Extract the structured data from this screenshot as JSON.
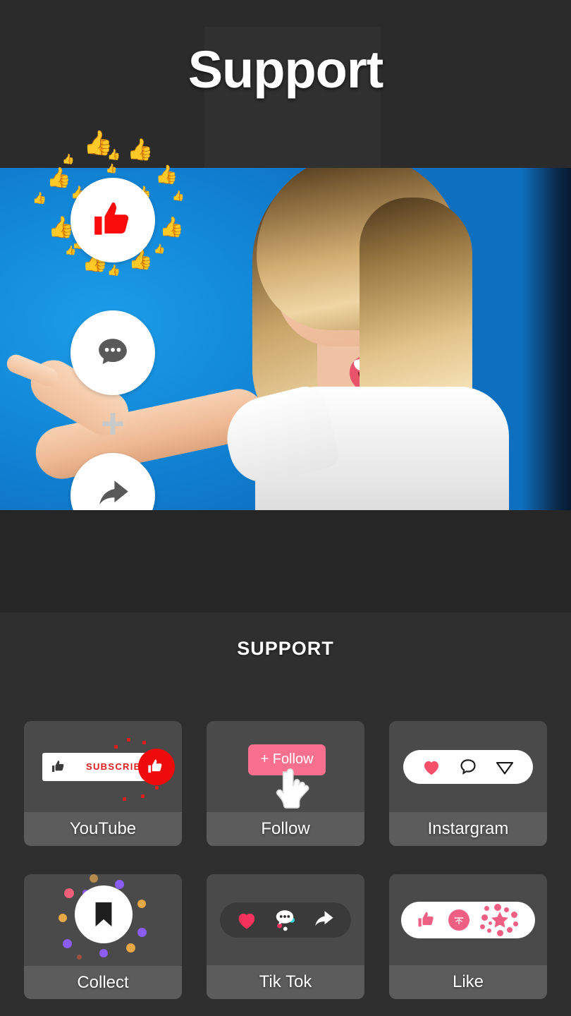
{
  "hero": {
    "title": "Support",
    "photo_alt": "woman pointing at social icons on blue background",
    "overlay_icons": [
      {
        "name": "like-thumbs-up",
        "color": "#f90b0b"
      },
      {
        "name": "comment-bubble",
        "color": "#595959"
      },
      {
        "name": "plus-sign",
        "label": "+",
        "color": "#c9c9c9"
      },
      {
        "name": "share-arrow",
        "color": "#595959"
      }
    ]
  },
  "panel": {
    "title": "SUPPORT",
    "cards": [
      {
        "id": "youtube",
        "label": "YouTube",
        "button_text": "SUBSCRIBE",
        "accent": "#ef0b0b",
        "art": "subscribe-bar"
      },
      {
        "id": "follow",
        "label": "Follow",
        "button_text": "+ Follow",
        "accent": "#f9708f",
        "art": "follow-button"
      },
      {
        "id": "instagram",
        "label": "Instargram",
        "accent": "#f4506a",
        "art": "instagram-pill"
      },
      {
        "id": "collect",
        "label": "Collect",
        "accent": "#ffffff",
        "art": "bookmark-burst"
      },
      {
        "id": "tiktok",
        "label": "Tik Tok",
        "accent": "#f4325c",
        "art": "tiktok-pill"
      },
      {
        "id": "like",
        "label": "Like",
        "accent": "#ef5f84",
        "art": "like-pill"
      }
    ]
  },
  "colors": {
    "page_bg": "#2a2a2a",
    "hero_bg": "#2b2b2b",
    "panel_bg": "#2f2f2f",
    "card_bg": "#4a4a4a",
    "card_label_bg": "#5c5c5c",
    "photo_blue": "#1389da",
    "text": "#ffffff"
  }
}
